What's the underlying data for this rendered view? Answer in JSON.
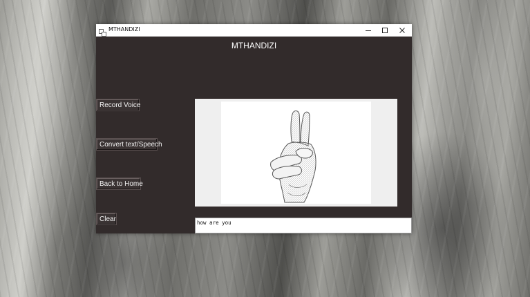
{
  "window": {
    "title": "MTHANDIZI",
    "controls": {
      "minimize": "—",
      "maximize": "☐",
      "close": "✕"
    }
  },
  "app": {
    "heading": "MTHANDIZI",
    "buttons": {
      "record_voice": "Record Voice",
      "convert": "Convert text/Speech",
      "back_home": "Back to Home",
      "clear": "Clear"
    },
    "sign_image": {
      "depicts": "hand-sign-icon"
    },
    "output_text": "how are you"
  },
  "colors": {
    "window_bg": "#322b2b",
    "button_bg": "#3a3333",
    "heading_text": "#ffffff"
  }
}
